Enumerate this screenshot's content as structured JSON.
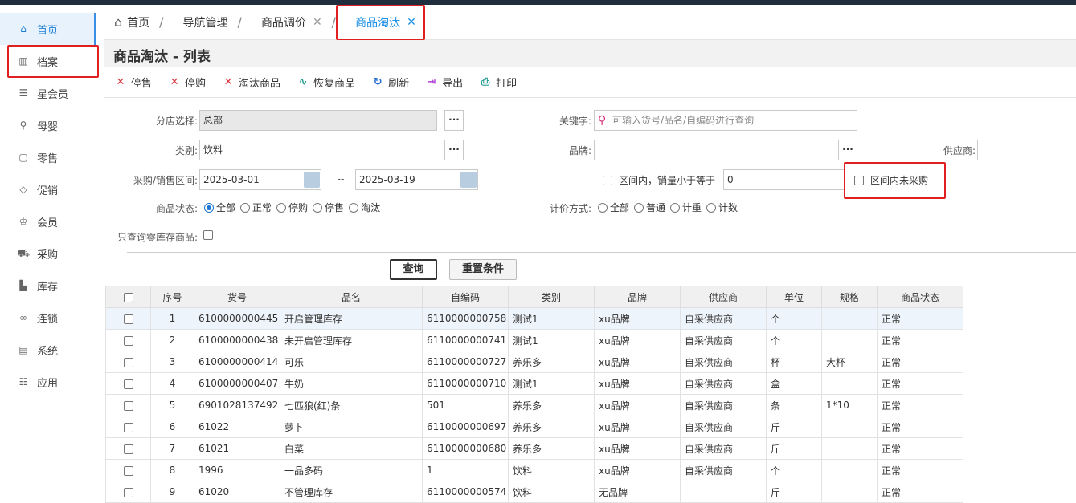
{
  "sidebar": {
    "items": [
      {
        "label": "首页",
        "icon": "home-icon",
        "glyph": "⌂",
        "active": true
      },
      {
        "label": "档案",
        "icon": "archive-icon",
        "glyph": "▥",
        "active": false
      },
      {
        "label": "星会员",
        "icon": "star-member-icon",
        "glyph": "☰",
        "active": false
      },
      {
        "label": "母婴",
        "icon": "baby-icon",
        "glyph": "♀",
        "active": false
      },
      {
        "label": "零售",
        "icon": "retail-icon",
        "glyph": "▢",
        "active": false
      },
      {
        "label": "促销",
        "icon": "tag-icon",
        "glyph": "◇",
        "active": false
      },
      {
        "label": "会员",
        "icon": "member-icon",
        "glyph": "♔",
        "active": false
      },
      {
        "label": "采购",
        "icon": "cart-icon",
        "glyph": "⛟",
        "active": false
      },
      {
        "label": "库存",
        "icon": "warehouse-icon",
        "glyph": "▙",
        "active": false
      },
      {
        "label": "连锁",
        "icon": "chain-icon",
        "glyph": "∞",
        "active": false
      },
      {
        "label": "系统",
        "icon": "system-icon",
        "glyph": "▤",
        "active": false
      },
      {
        "label": "应用",
        "icon": "apps-icon",
        "glyph": "☷",
        "active": false
      }
    ]
  },
  "tabs": [
    {
      "label": "首页",
      "closable": false,
      "active": false
    },
    {
      "label": "导航管理",
      "closable": false,
      "active": false
    },
    {
      "label": "商品调价",
      "closable": true,
      "active": false
    },
    {
      "label": "商品淘汰",
      "closable": true,
      "active": true
    }
  ],
  "page_title": "商品淘汰 - 列表",
  "toolbar": [
    {
      "label": "停售",
      "icon": "stop-sale-icon",
      "glyph": "✕",
      "color": "#d9363e"
    },
    {
      "label": "停购",
      "icon": "stop-purchase-icon",
      "glyph": "✕",
      "color": "#d9363e"
    },
    {
      "label": "淘汰商品",
      "icon": "eliminate-icon",
      "glyph": "✕",
      "color": "#d9363e"
    },
    {
      "label": "恢复商品",
      "icon": "restore-icon",
      "glyph": "∿",
      "color": "#1a9a8a"
    },
    {
      "label": "刷新",
      "icon": "refresh-icon",
      "glyph": "↻",
      "color": "#2a6fd6"
    },
    {
      "label": "导出",
      "icon": "export-icon",
      "glyph": "⇥",
      "color": "#b44fd6"
    },
    {
      "label": "打印",
      "icon": "print-icon",
      "glyph": "⎙",
      "color": "#1a9a8a"
    }
  ],
  "form": {
    "store_label": "分店选择:",
    "store_value": "总部",
    "keyword_label": "关键字:",
    "keyword_placeholder": "可输入货号/品名/自编码进行查询",
    "category_label": "类别:",
    "category_value": "饮料",
    "brand_label": "品牌:",
    "brand_value": "",
    "supplier_label": "供应商:",
    "supplier_value": "",
    "range_label": "采购/销售区间:",
    "date_from": "2025-03-01",
    "date_sep": "--",
    "date_to": "2025-03-19",
    "sales_less_label": "区间内，销量小于等于",
    "sales_less_value": "0",
    "not_purchased_label": "区间内未采购",
    "status_label": "商品状态:",
    "status_options": [
      "全部",
      "正常",
      "停购",
      "停售",
      "淘汰"
    ],
    "status_selected": "全部",
    "pricing_label": "计价方式:",
    "pricing_options": [
      "全部",
      "普通",
      "计重",
      "计数"
    ],
    "zero_stock_label": "只查询零库存商品:",
    "query_button": "查询",
    "reset_button": "重置条件",
    "dots": "···"
  },
  "table": {
    "columns": [
      "",
      "序号",
      "货号",
      "品名",
      "自编码",
      "类别",
      "品牌",
      "供应商",
      "单位",
      "规格",
      "商品状态"
    ],
    "rows": [
      [
        "1",
        "6100000000445",
        "开启管理库存",
        "6110000000758",
        "测试1",
        "xu品牌",
        "自采供应商",
        "个",
        "",
        "正常"
      ],
      [
        "2",
        "6100000000438",
        "未开启管理库存",
        "6110000000741",
        "测试1",
        "xu品牌",
        "自采供应商",
        "个",
        "",
        "正常"
      ],
      [
        "3",
        "6100000000414",
        "可乐",
        "6110000000727",
        "养乐多",
        "xu品牌",
        "自采供应商",
        "杯",
        "大杯",
        "正常"
      ],
      [
        "4",
        "6100000000407",
        "牛奶",
        "6110000000710",
        "测试1",
        "xu品牌",
        "自采供应商",
        "盒",
        "",
        "正常"
      ],
      [
        "5",
        "6901028137492",
        "七匹狼(红)条",
        "501",
        "养乐多",
        "xu品牌",
        "自采供应商",
        "条",
        "1*10",
        "正常"
      ],
      [
        "6",
        "61022",
        "萝卜",
        "6110000000697",
        "养乐多",
        "xu品牌",
        "自采供应商",
        "斤",
        "",
        "正常"
      ],
      [
        "7",
        "61021",
        "白菜",
        "6110000000680",
        "养乐多",
        "xu品牌",
        "自采供应商",
        "斤",
        "",
        "正常"
      ],
      [
        "8",
        "1996",
        "一品多码",
        "1",
        "饮料",
        "xu品牌",
        "自采供应商",
        "个",
        "",
        "正常"
      ],
      [
        "9",
        "61020",
        "不管理库存",
        "6110000000574",
        "饮料",
        "无品牌",
        "",
        "斤",
        "",
        "正常"
      ]
    ]
  }
}
